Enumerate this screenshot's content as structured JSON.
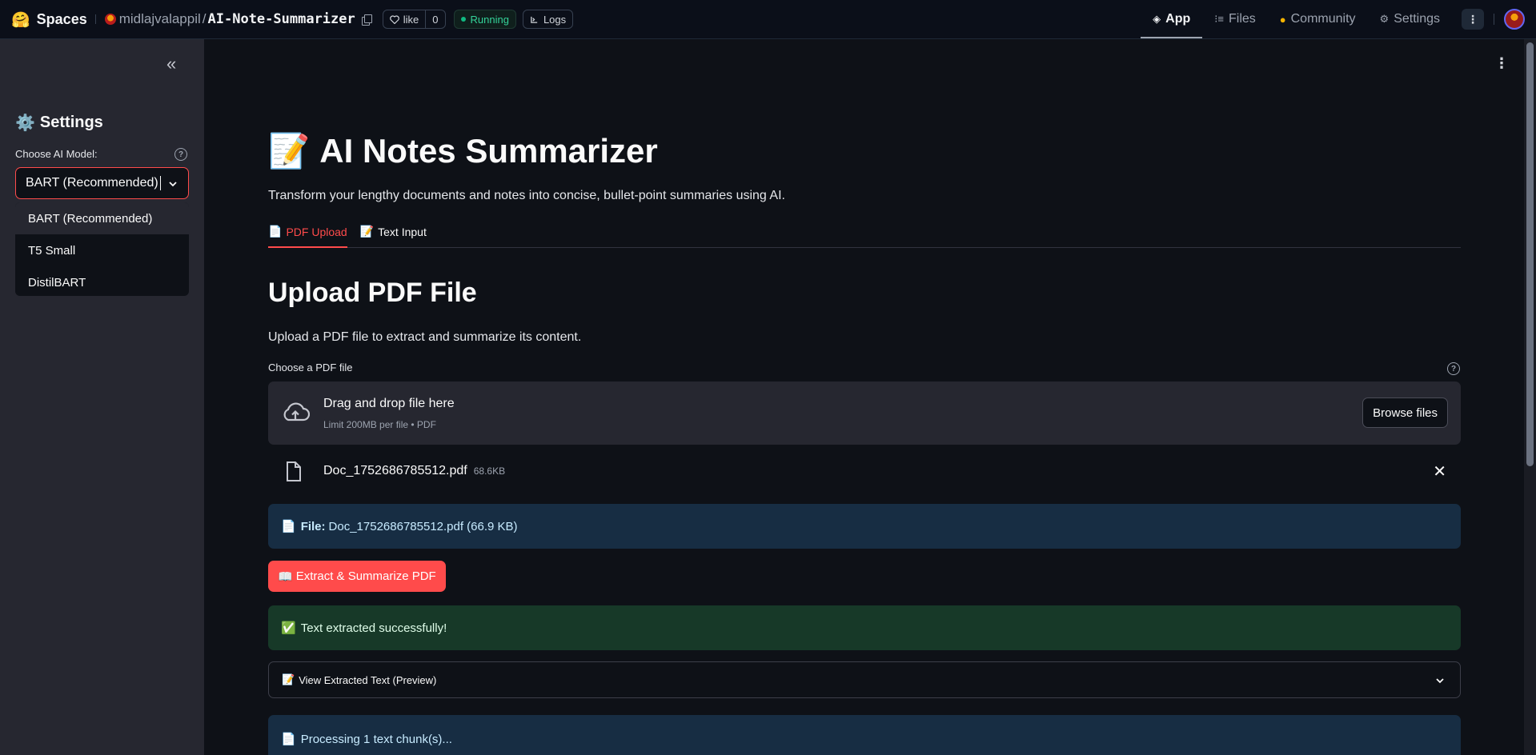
{
  "topbar": {
    "brand": "Spaces",
    "owner": "midlajvalappil",
    "slash": "/",
    "repo": "AI-Note-Summarizer",
    "like_label": "like",
    "like_count": "0",
    "status": "Running",
    "logs_label": "Logs",
    "nav": [
      {
        "label": "App",
        "icon": "cube-icon"
      },
      {
        "label": "Files",
        "icon": "files-icon"
      },
      {
        "label": "Community",
        "icon": "community-icon"
      },
      {
        "label": "Settings",
        "icon": "gear-icon"
      }
    ],
    "kebab": "⋮"
  },
  "sidebar": {
    "collapse_glyph": "«",
    "title_icon": "⚙️",
    "title": "Settings",
    "model_label": "Choose AI Model:",
    "help_glyph": "?",
    "selected_model": "BART (Recommended)",
    "chevron": "⌄",
    "options": [
      "BART (Recommended)",
      "T5 Small",
      "DistilBART"
    ]
  },
  "main": {
    "kebab": "⋮",
    "title_icon": "📝",
    "title": "AI Notes Summarizer",
    "subtitle": "Transform your lengthy documents and notes into concise, bullet-point summaries using AI.",
    "tabs": [
      {
        "icon": "📄",
        "label": "PDF Upload"
      },
      {
        "icon": "📝",
        "label": "Text Input"
      }
    ],
    "section_title": "Upload PDF File",
    "section_desc": "Upload a PDF file to extract and summarize its content.",
    "uploader_label": "Choose a PDF file",
    "dropzone_title": "Drag and drop file here",
    "dropzone_sub": "Limit 200MB per file • PDF",
    "browse_label": "Browse files",
    "uploaded_file": {
      "name": "Doc_1752686785512.pdf",
      "size": "68.6KB"
    },
    "remove_glyph": "✕",
    "file_info_icon": "📄",
    "file_info_bold": "File:",
    "file_info_text": "Doc_1752686785512.pdf (66.9 KB)",
    "extract_icon": "📖",
    "extract_label": "Extract & Summarize PDF",
    "success_icon": "✅",
    "success_text": "Text extracted successfully!",
    "expander_icon": "📝",
    "expander_label": "View Extracted Text (Preview)",
    "expander_chevron": "⌄",
    "processing_icon": "📄",
    "processing_text": "Processing 1 text chunk(s)..."
  },
  "colors": {
    "accent": "#ff4b4b",
    "background": "#0e1117",
    "sidebar": "#262730",
    "info": "#172d43",
    "success": "#173928",
    "running": "#34d399"
  }
}
